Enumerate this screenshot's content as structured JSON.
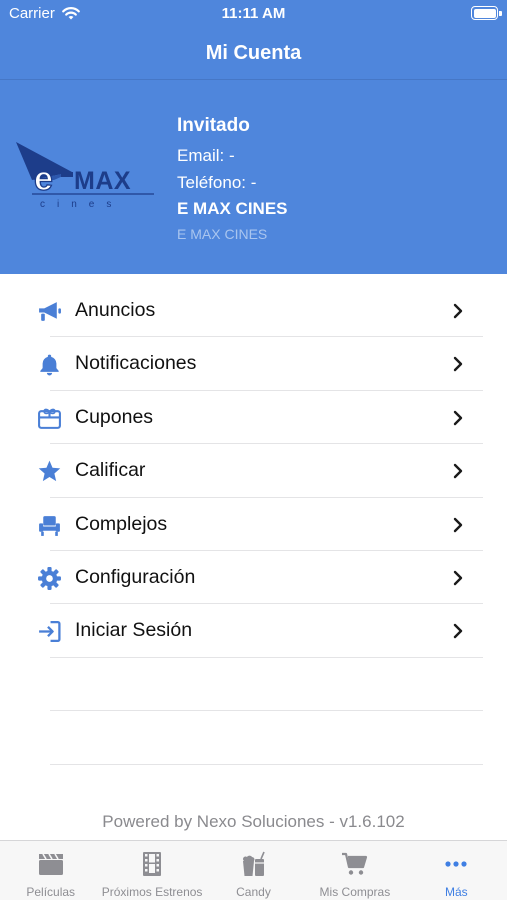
{
  "status_bar": {
    "carrier": "Carrier",
    "time": "11:11 AM"
  },
  "nav": {
    "title": "Mi Cuenta"
  },
  "profile": {
    "logo_text": "E-MAX",
    "logo_sub": "cines",
    "name": "Invitado",
    "email": "Email: -",
    "phone": "Teléfono: -",
    "company": "E MAX CINES",
    "company_sub": "E MAX CINES"
  },
  "menu": {
    "items": [
      {
        "label": "Anuncios",
        "icon": "megaphone-icon"
      },
      {
        "label": "Notificaciones",
        "icon": "bell-icon"
      },
      {
        "label": "Cupones",
        "icon": "gift-card-icon"
      },
      {
        "label": "Calificar",
        "icon": "star-icon"
      },
      {
        "label": "Complejos",
        "icon": "cinema-seat-icon"
      },
      {
        "label": "Configuración",
        "icon": "gear-icon"
      },
      {
        "label": "Iniciar Sesión",
        "icon": "sign-in-icon"
      }
    ]
  },
  "footer": {
    "text": "Powered by Nexo Soluciones - v1.6.102"
  },
  "tabs": [
    {
      "label": "Películas",
      "icon": "clapperboard-icon",
      "active": false
    },
    {
      "label": "Próximos Estrenos",
      "icon": "film-strip-icon",
      "active": false
    },
    {
      "label": "Candy",
      "icon": "popcorn-drink-icon",
      "active": false
    },
    {
      "label": "Mis Compras",
      "icon": "cart-icon",
      "active": false
    },
    {
      "label": "Más",
      "icon": "more-dots-icon",
      "active": true
    }
  ],
  "colors": {
    "primary": "#4f86dc",
    "accent": "#3f7fe3",
    "icon": "#4a7fd6",
    "inactive": "#8e8e93"
  }
}
